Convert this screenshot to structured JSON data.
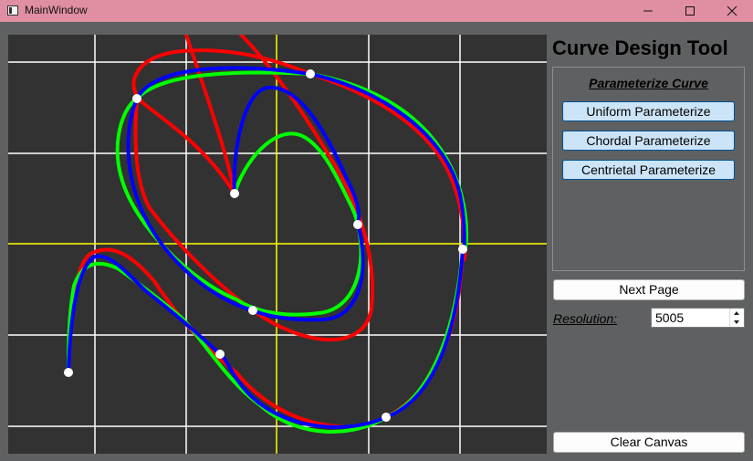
{
  "window": {
    "title": "MainWindow"
  },
  "panel": {
    "title": "Curve Design Tool",
    "group_title": "Parameterize Curve",
    "buttons": {
      "uniform": "Uniform Parameterize",
      "chordal": "Chordal Parameterize",
      "centrietal": "Centrietal Parameterize"
    },
    "next_page": "Next Page",
    "resolution_label": "Resolution:",
    "resolution_value": "5005",
    "clear_canvas": "Clear Canvas"
  },
  "colors": {
    "canvas_bg": "#323232",
    "grid": "#ffffff",
    "axis": "#ffff00",
    "uniform_curve": "#ff0000",
    "chordal_curve": "#00ff00",
    "centrietal_curve": "#0000ff",
    "point": "#ffffff"
  }
}
